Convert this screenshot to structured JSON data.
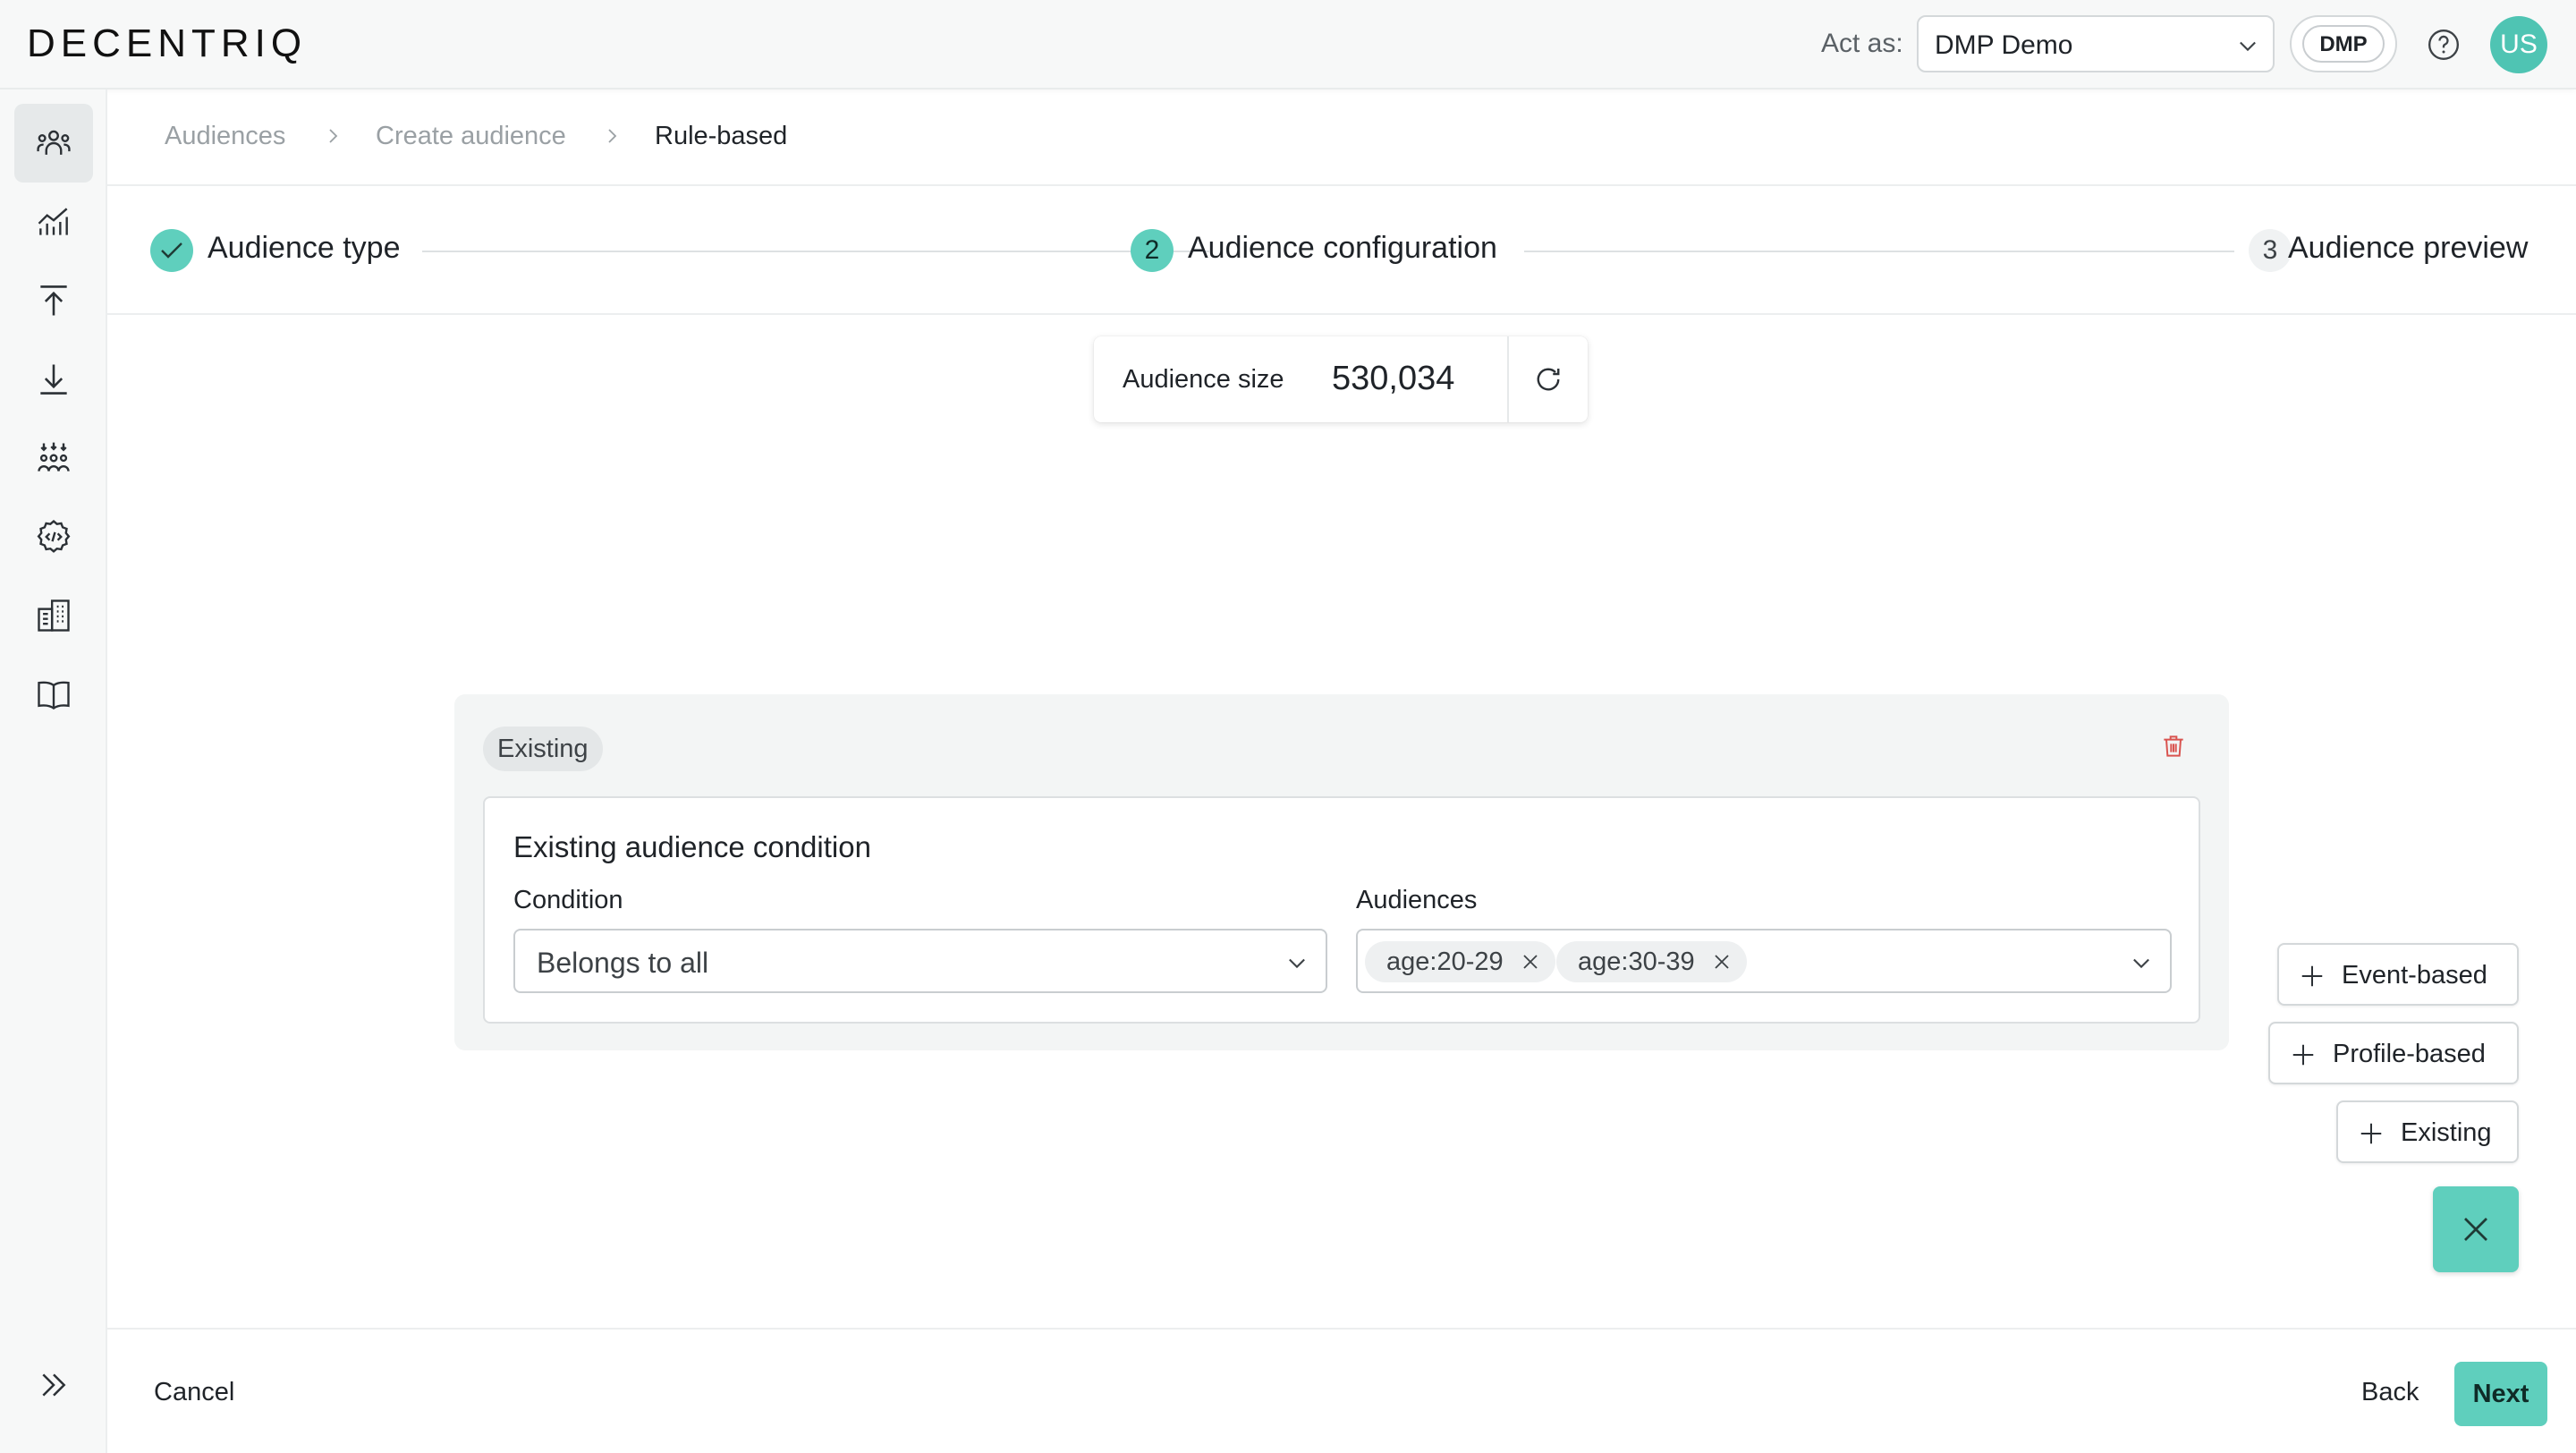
{
  "header": {
    "logo": "DECENTRIQ",
    "act_as_label": "Act as:",
    "act_as_value": "DMP Demo",
    "role_badge": "DMP",
    "avatar_initials": "US"
  },
  "sidebar": {
    "items": [
      {
        "icon": "audiences-icon",
        "active": true
      },
      {
        "icon": "insights-icon",
        "active": false
      },
      {
        "icon": "upload-icon",
        "active": false
      },
      {
        "icon": "download-icon",
        "active": false
      },
      {
        "icon": "collaboration-icon",
        "active": false
      },
      {
        "icon": "developer-settings-icon",
        "active": false
      },
      {
        "icon": "organizations-icon",
        "active": false
      },
      {
        "icon": "docs-book-icon",
        "active": false
      }
    ],
    "expand_icon": "double-chevron-right-icon"
  },
  "breadcrumb": {
    "items": [
      "Audiences",
      "Create audience",
      "Rule-based"
    ]
  },
  "stepper": {
    "steps": [
      {
        "number": "",
        "label": "Audience type",
        "status": "completed"
      },
      {
        "number": "2",
        "label": "Audience configuration",
        "status": "active"
      },
      {
        "number": "3",
        "label": "Audience preview",
        "status": "pending"
      }
    ]
  },
  "audience_size": {
    "label": "Audience size",
    "value": "530,034"
  },
  "condition_block": {
    "badge": "Existing",
    "title": "Existing audience condition",
    "condition_label": "Condition",
    "condition_value": "Belongs to all",
    "audiences_label": "Audiences",
    "audiences": [
      "age:20-29",
      "age:30-39"
    ]
  },
  "add_buttons": {
    "event_based": "Event-based",
    "profile_based": "Profile-based",
    "existing": "Existing"
  },
  "footer": {
    "cancel": "Cancel",
    "back": "Back",
    "next": "Next"
  },
  "colors": {
    "accent": "#5fcfbd",
    "avatar": "#4fc4b3",
    "delete": "#d9534f"
  }
}
